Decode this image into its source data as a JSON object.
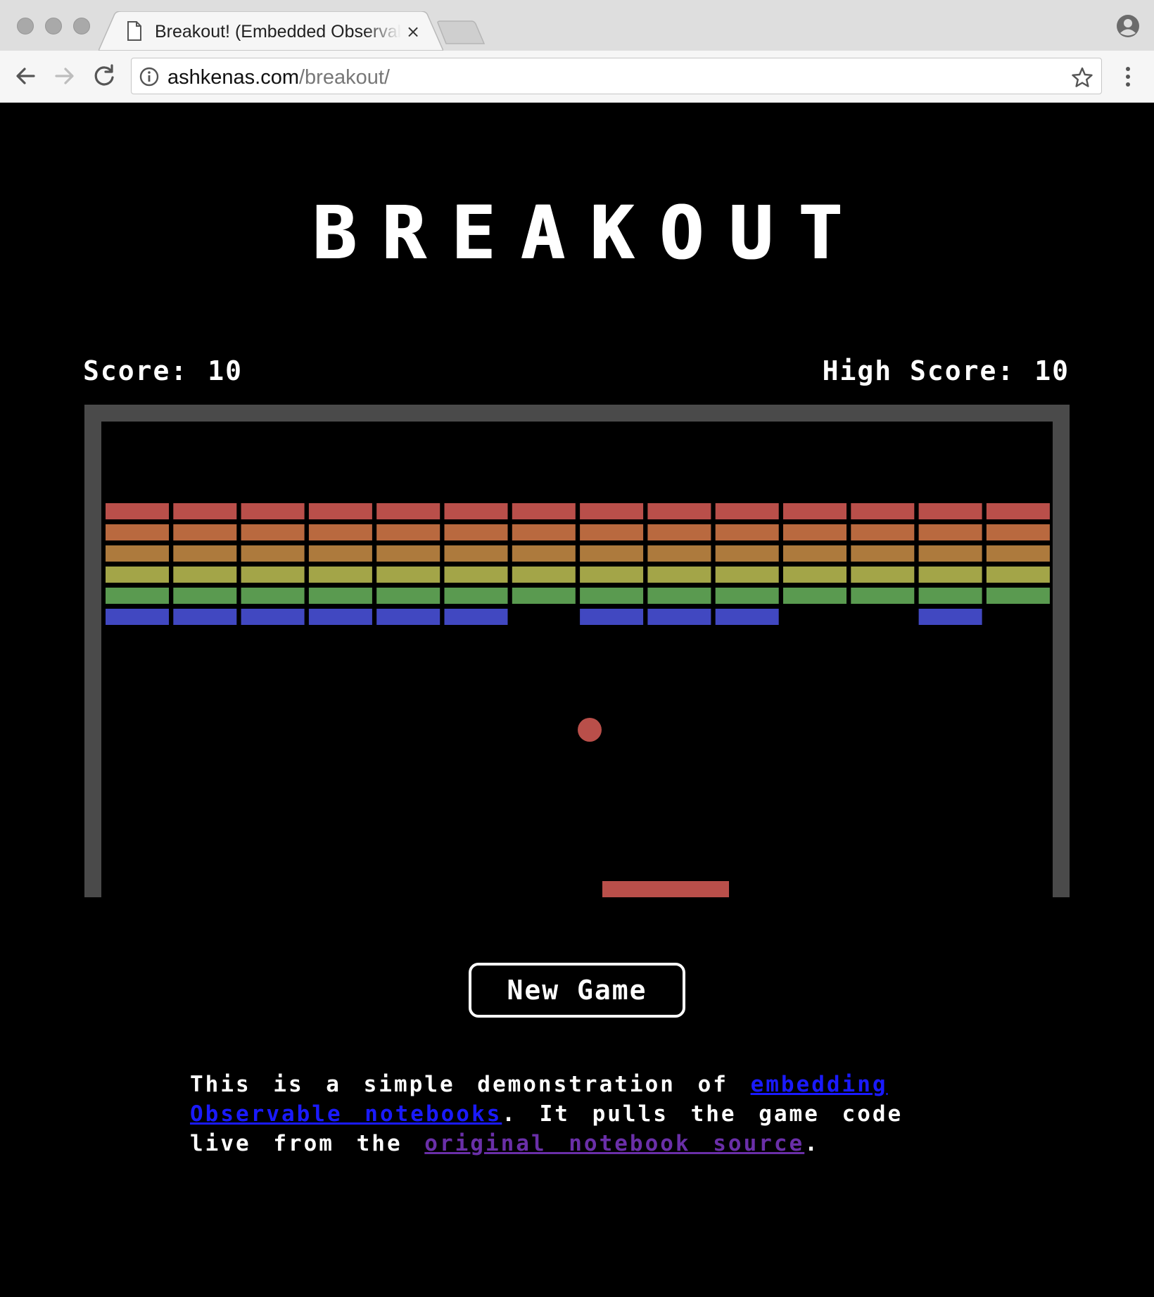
{
  "browser": {
    "tab_title": "Breakout! (Embedded Observable Notebook)",
    "tab_close": "×",
    "url_host": "ashkenas.com",
    "url_path": "/breakout/"
  },
  "page": {
    "title": "BREAKOUT",
    "score_label": "Score:",
    "score_value": "10",
    "high_score_label": "High Score:",
    "high_score_value": "10",
    "new_game_label": "New Game",
    "description": {
      "part1": "This is a simple demonstration of ",
      "link1": "embedding Observable notebooks",
      "part2": ". It pulls the game code live from the ",
      "link2": "original notebook source",
      "part3": "."
    }
  },
  "game": {
    "columns": 14,
    "row_colors": [
      "#b94f4a",
      "#b9693f",
      "#ad7a3d",
      "#a3a548",
      "#5a9a50",
      "#4148c1"
    ],
    "rows": [
      [
        1,
        1,
        1,
        1,
        1,
        1,
        1,
        1,
        1,
        1,
        1,
        1,
        1,
        1
      ],
      [
        1,
        1,
        1,
        1,
        1,
        1,
        1,
        1,
        1,
        1,
        1,
        1,
        1,
        1
      ],
      [
        1,
        1,
        1,
        1,
        1,
        1,
        1,
        1,
        1,
        1,
        1,
        1,
        1,
        1
      ],
      [
        1,
        1,
        1,
        1,
        1,
        1,
        1,
        1,
        1,
        1,
        1,
        1,
        1,
        1
      ],
      [
        1,
        1,
        1,
        1,
        1,
        1,
        1,
        1,
        1,
        1,
        1,
        1,
        1,
        1
      ],
      [
        1,
        1,
        1,
        1,
        1,
        1,
        0,
        1,
        1,
        1,
        0,
        0,
        1,
        0
      ]
    ],
    "wall_color": "#4a4a4a",
    "ball_color": "#b94f4a",
    "paddle_color": "#b94f4a"
  }
}
